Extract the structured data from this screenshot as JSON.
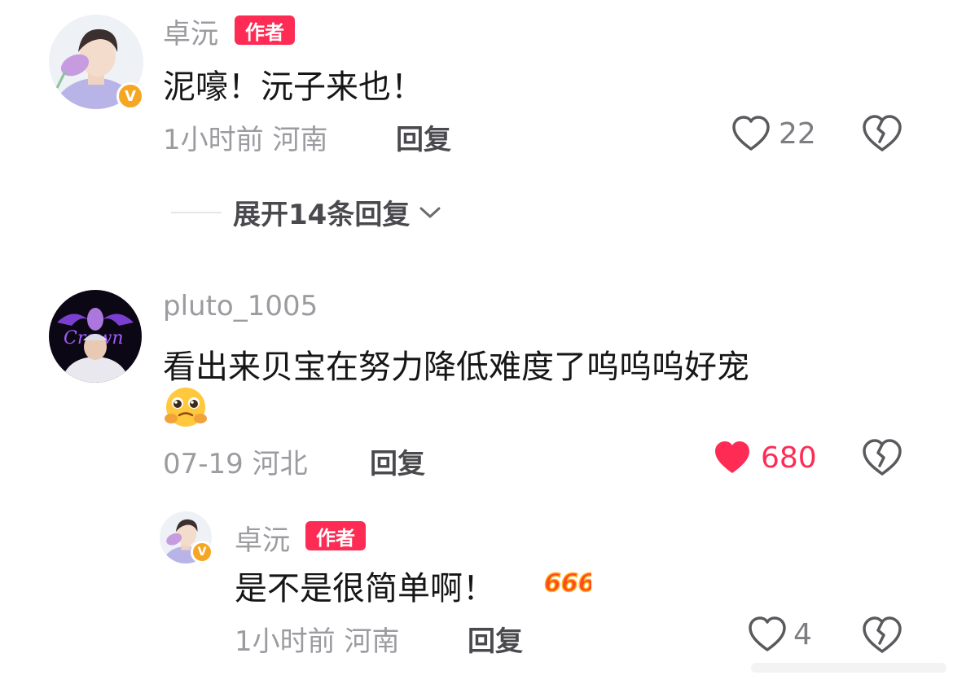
{
  "comments": [
    {
      "username": "卓沅",
      "tag": "作者",
      "text": "泥嚎！沅子来也！",
      "meta": "1小时前 河南",
      "reply_label": "回复",
      "likes": "22",
      "liked": false,
      "expand_label": "展开14条回复"
    },
    {
      "username": "pluto_1005",
      "text": "看出来贝宝在努力降低难度了呜呜呜好宠",
      "emoji": "pleading-face",
      "meta": "07-19 河北",
      "reply_label": "回复",
      "likes": "680",
      "liked": true,
      "replies": [
        {
          "username": "卓沅",
          "tag": "作者",
          "text": "是不是很简单啊！",
          "emoji": "666",
          "meta": "1小时前 河南",
          "reply_label": "回复",
          "likes": "4",
          "liked": false
        }
      ]
    }
  ],
  "colors": {
    "accent": "#fe2c55",
    "badge": "#f5a623",
    "muted_text": "#9b9ba0"
  }
}
